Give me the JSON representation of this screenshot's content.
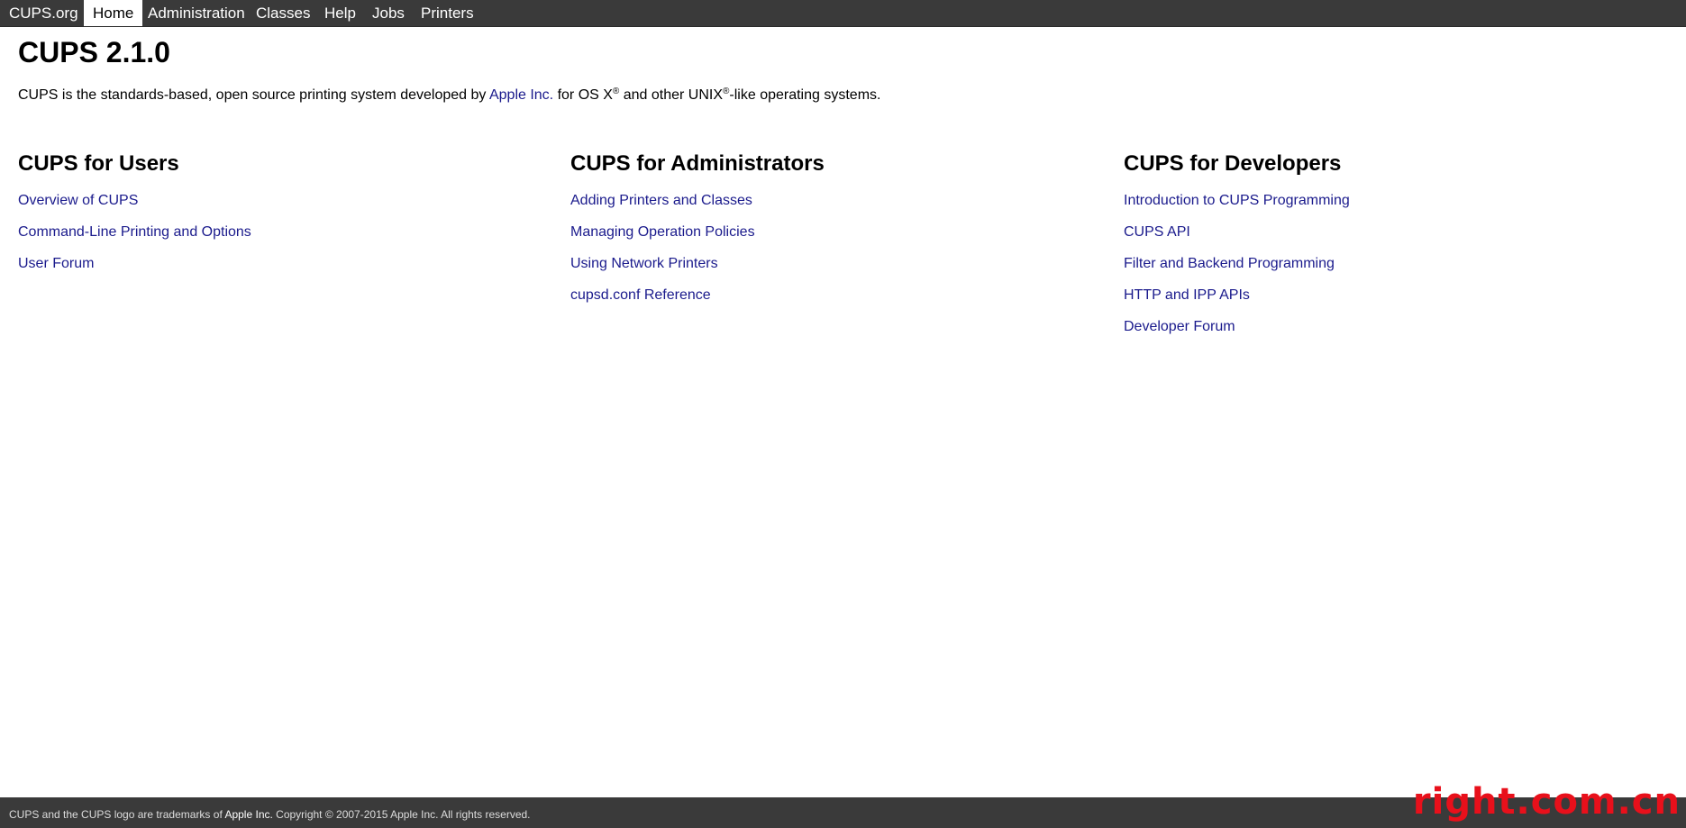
{
  "nav": {
    "items": [
      {
        "label": "CUPS.org",
        "active": false
      },
      {
        "label": "Home",
        "active": true
      },
      {
        "label": "Administration",
        "active": false
      },
      {
        "label": "Classes",
        "active": false
      },
      {
        "label": "Help",
        "active": false
      },
      {
        "label": "Jobs",
        "active": false
      },
      {
        "label": "Printers",
        "active": false
      }
    ]
  },
  "main": {
    "title": "CUPS 2.1.0",
    "intro": {
      "part1": "CUPS is the standards-based, open source printing system developed by ",
      "apple_link": "Apple Inc.",
      "part2": " for OS X",
      "reg1": "®",
      "part3": " and other UNIX",
      "reg2": "®",
      "part4": "-like operating systems."
    }
  },
  "columns": [
    {
      "heading": "CUPS for Users",
      "links": [
        "Overview of CUPS",
        "Command-Line Printing and Options",
        "User Forum"
      ]
    },
    {
      "heading": "CUPS for Administrators",
      "links": [
        "Adding Printers and Classes",
        "Managing Operation Policies",
        "Using Network Printers",
        "cupsd.conf Reference"
      ]
    },
    {
      "heading": "CUPS for Developers",
      "links": [
        "Introduction to CUPS Programming",
        "CUPS API",
        "Filter and Backend Programming",
        "HTTP and IPP APIs",
        "Developer Forum"
      ]
    }
  ],
  "footer": {
    "part1": "CUPS and the CUPS logo are trademarks of ",
    "apple": "Apple Inc.",
    "part2": " Copyright © 2007-2015 Apple Inc. All rights reserved."
  },
  "watermark": "right.com.cn",
  "colors": {
    "bar": "#3a3a3a",
    "link": "#1a1a8c",
    "watermark": "#e8101b"
  }
}
